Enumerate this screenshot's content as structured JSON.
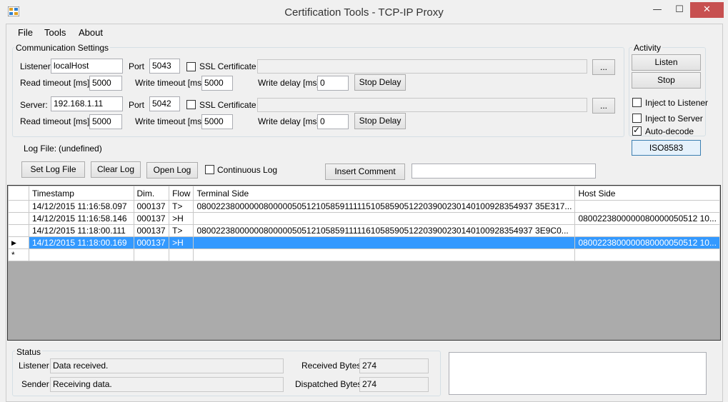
{
  "window": {
    "title": "Certification Tools - TCP-IP Proxy",
    "minimize": "—",
    "maximize": "☐",
    "close": "✕"
  },
  "menu": [
    "File",
    "Tools",
    "About"
  ],
  "communication": {
    "legend": "Communication Settings",
    "listener": {
      "label": "Listener:",
      "value": "localHost",
      "port_label": "Port",
      "port": "5043",
      "ssl_label": "SSL Certificate",
      "ssl_checked": false,
      "ssl_path": "",
      "browse": "...",
      "read_timeout_label": "Read timeout [ms]:",
      "read_timeout": "5000",
      "write_timeout_label": "Write timeout [ms]:",
      "write_timeout": "5000",
      "write_delay_label": "Write delay [ms]:",
      "write_delay": "0",
      "stop_delay": "Stop Delay"
    },
    "server": {
      "label": "Server:",
      "value": "192.168.1.11",
      "port_label": "Port",
      "port": "5042",
      "ssl_label": "SSL Certificate",
      "ssl_checked": false,
      "ssl_path": "",
      "browse": "...",
      "read_timeout_label": "Read timeout [ms]:",
      "read_timeout": "5000",
      "write_timeout_label": "Write timeout [ms]:",
      "write_timeout": "5000",
      "write_delay_label": "Write delay [ms]:",
      "write_delay": "0",
      "stop_delay": "Stop Delay"
    }
  },
  "activity": {
    "legend": "Activity",
    "listen": "Listen",
    "stop": "Stop",
    "inject_listener": "Inject to Listener",
    "inject_server": "Inject to Server",
    "auto_decode": "Auto-decode",
    "auto_decode_checked": true,
    "iso": "ISO8583"
  },
  "log": {
    "file_label": "Log File:",
    "file_value": "(undefined)",
    "set_log": "Set Log File",
    "clear_log": "Clear Log",
    "open_log": "Open Log",
    "continuous": "Continuous Log",
    "insert_comment": "Insert Comment",
    "comment_value": ""
  },
  "grid": {
    "columns": [
      "Timestamp",
      "Dim.",
      "Flow",
      "Terminal Side",
      "Host Side"
    ],
    "rows": [
      {
        "marker": "",
        "timestamp": "14/12/2015 11:16:58.097",
        "dim": "000137",
        "flow": "T>",
        "terminal": "08002238000000800000505121058591111151058590512203900230140100928354937 35E317...",
        "host": ""
      },
      {
        "marker": "",
        "timestamp": "14/12/2015 11:16:58.146",
        "dim": "000137",
        "flow": ">H",
        "terminal": "",
        "host": "0800223800000080000050512 10..."
      },
      {
        "marker": "",
        "timestamp": "14/12/2015 11:18:00.111",
        "dim": "000137",
        "flow": "T>",
        "terminal": "08002238000000800000505121058591111161058590512203900230140100928354937 3E9C0...",
        "host": ""
      },
      {
        "marker": "▶",
        "timestamp": "14/12/2015 11:18:00.169",
        "dim": "000137",
        "flow": ">H",
        "terminal": "",
        "host": "0800223800000080000050512 10..."
      }
    ],
    "new_row_marker": "*"
  },
  "status": {
    "legend": "Status",
    "listener_label": "Listener",
    "listener_value": "Data received.",
    "sender_label": "Sender",
    "sender_value": "Receiving data.",
    "received_label": "Received Bytes:",
    "received_value": "274",
    "dispatched_label": "Dispatched Bytes:",
    "dispatched_value": "274"
  },
  "colors": {
    "selection": "#3399ff",
    "close_button": "#c75050"
  }
}
